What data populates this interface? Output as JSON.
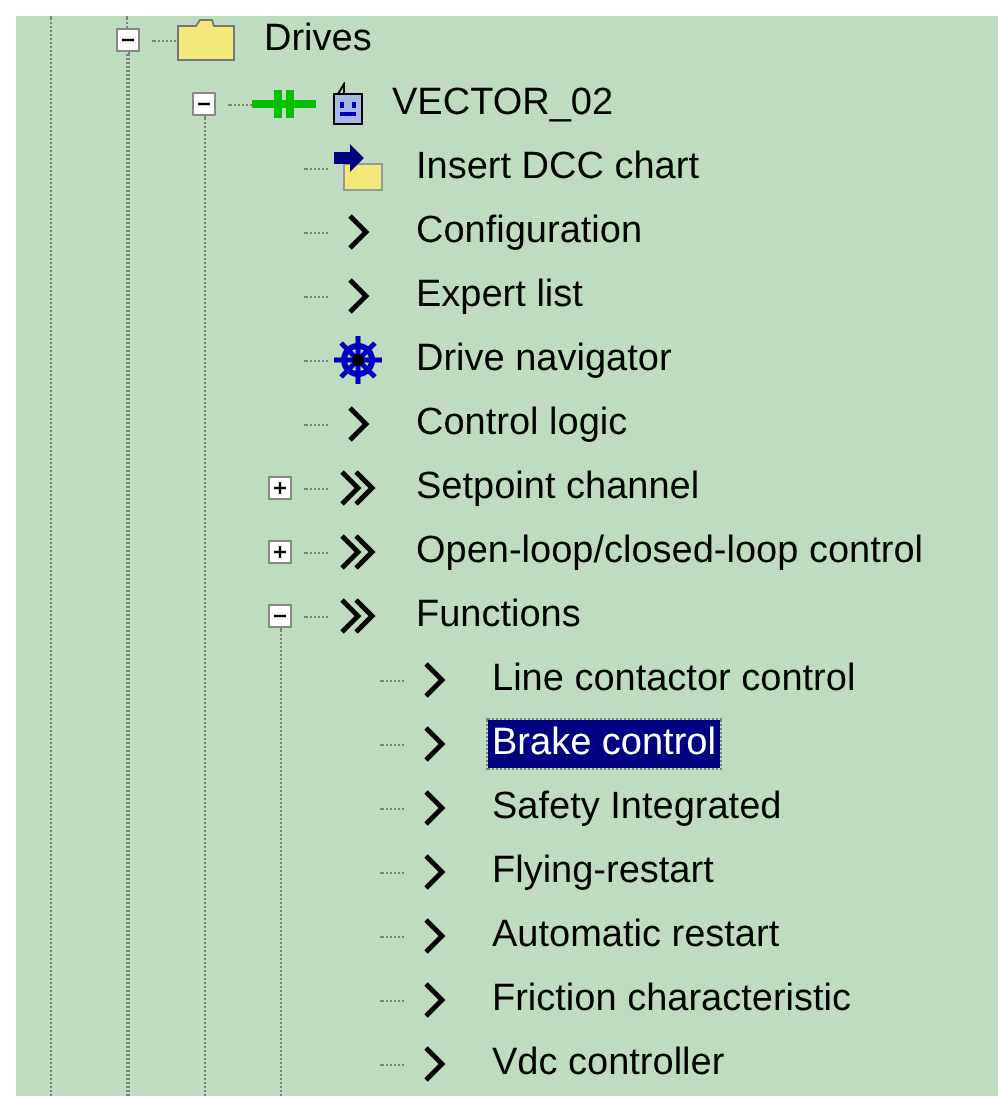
{
  "tree": [
    {
      "label": "Drives",
      "kind": "folder",
      "selected": false,
      "expanded": true,
      "children": [
        {
          "label": "VECTOR_02",
          "kind": "drive",
          "selected": false,
          "expanded": true,
          "children": [
            {
              "label": "Insert DCC chart",
              "kind": "insert",
              "selected": false
            },
            {
              "label": "Configuration",
              "kind": "function",
              "selected": false
            },
            {
              "label": "Expert list",
              "kind": "function",
              "selected": false
            },
            {
              "label": "Drive navigator",
              "kind": "navigator",
              "selected": false
            },
            {
              "label": "Control logic",
              "kind": "function",
              "selected": false
            },
            {
              "label": "Setpoint channel",
              "kind": "group",
              "selected": false,
              "expanded": false
            },
            {
              "label": "Open-loop/closed-loop control",
              "kind": "group",
              "selected": false,
              "expanded": false
            },
            {
              "label": "Functions",
              "kind": "group",
              "selected": false,
              "expanded": true,
              "children": [
                {
                  "label": "Line contactor control",
                  "kind": "function",
                  "selected": false
                },
                {
                  "label": "Brake control",
                  "kind": "function",
                  "selected": true
                },
                {
                  "label": "Safety Integrated",
                  "kind": "function",
                  "selected": false
                },
                {
                  "label": "Flying-restart",
                  "kind": "function",
                  "selected": false
                },
                {
                  "label": "Automatic restart",
                  "kind": "function",
                  "selected": false
                },
                {
                  "label": "Friction characteristic",
                  "kind": "function",
                  "selected": false
                },
                {
                  "label": "Vdc controller",
                  "kind": "function",
                  "selected": false
                }
              ]
            }
          ]
        }
      ]
    }
  ]
}
